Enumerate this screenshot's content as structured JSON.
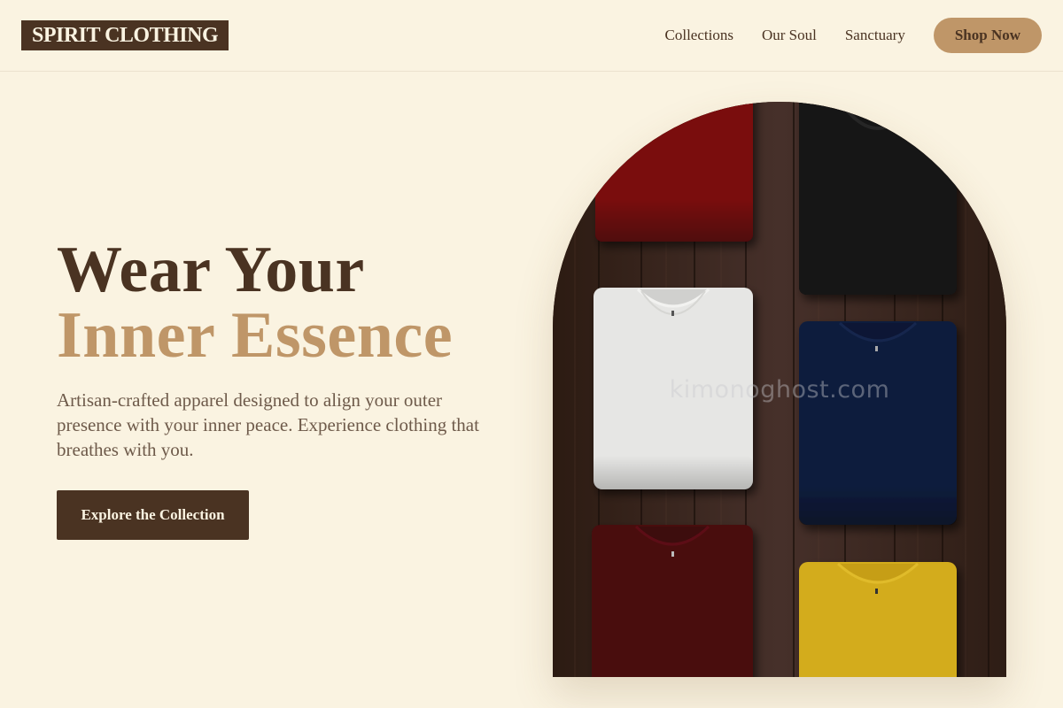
{
  "header": {
    "logo": "SPIRIT CLOTHING",
    "nav": [
      {
        "label": "Collections"
      },
      {
        "label": "Our Soul"
      },
      {
        "label": "Sanctuary"
      }
    ],
    "cta": "Shop Now"
  },
  "hero": {
    "title_line1": "Wear Your",
    "title_line2": "Inner Essence",
    "description": "Artisan-crafted apparel designed to align your outer presence with your inner peace. Experience clothing that breathes with you.",
    "cta": "Explore the Collection"
  },
  "image": {
    "watermark": "kimonoghost.com",
    "shirt_colors": [
      "#7a0a0c",
      "#141414",
      "#e6e6e4",
      "#0c1d3e",
      "#4a0a0d",
      "#d3ac1e"
    ]
  },
  "colors": {
    "background": "#faf3e1",
    "primary": "#4a3322",
    "accent": "#bf9668"
  }
}
